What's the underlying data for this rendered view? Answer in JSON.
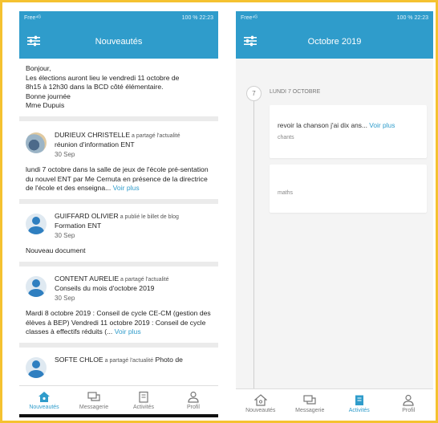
{
  "left": {
    "status": {
      "carrier": "Free⁴ᴳ",
      "battery": "100 %",
      "time": "22:23"
    },
    "title": "Nouveautés",
    "announcement": {
      "lines": [
        "Bonjour,",
        "Les élections auront lieu le vendredi 11 octobre de",
        "8h15 à 12h30 dans la BCD côté élémentaire.",
        "Bonne journée",
        "Mme Dupuis"
      ]
    },
    "posts": [
      {
        "author": "DURIEUX CHRISTELLE",
        "action": " a partagé l'actualité",
        "subject": "réunion d'information ENT",
        "date": "30 Sep",
        "body": "lundi 7 octobre dans la salle de jeux de l'école pré-sentation du nouvel ENT par Me Cernuta en présence de la directrice de l'école et des enseigna...",
        "more": "Voir plus"
      },
      {
        "author": "GUIFFARD OLIVIER",
        "action": " a publié le billet de blog",
        "subject": "Formation ENT",
        "date": "30 Sep",
        "body": "Nouveau document",
        "more": ""
      },
      {
        "author": "CONTENT AURELIE",
        "action": " a partagé l'actualité",
        "subject": "Conseils du  mois d'octobre 2019",
        "date": "30 Sep",
        "body": "Mardi 8 octobre 2019 : Conseil de cycle CE-CM (gestion des élèves à BEP) Vendredi 11 octobre 2019 : Conseil de cycle classes à effectifs réduits (...",
        "more": "Voir plus"
      },
      {
        "author": "SOFTE CHLOE",
        "action": " a partagé l'actualité",
        "subject": "Photo de",
        "date": "",
        "body": "",
        "more": ""
      }
    ],
    "nav": [
      "Nouveautés",
      "Messagerie",
      "Activités",
      "Profil"
    ]
  },
  "right": {
    "status": {
      "carrier": "Free⁴ᴳ",
      "battery": "100 %",
      "time": "22:23"
    },
    "title": "Octobre 2019",
    "day_number": "7",
    "day_label": "LUNDI 7 OCTOBRE",
    "activities": [
      {
        "title": "revoir la chanson  j'ai dix ans...",
        "more": "Voir plus",
        "tag": "chants"
      },
      {
        "title": "",
        "more": "",
        "tag": "maths"
      }
    ],
    "nav": [
      "Nouveautés",
      "Messagerie",
      "Activités",
      "Profil"
    ]
  },
  "colors": {
    "primary": "#2f9ccb",
    "frame": "#f5c230"
  }
}
